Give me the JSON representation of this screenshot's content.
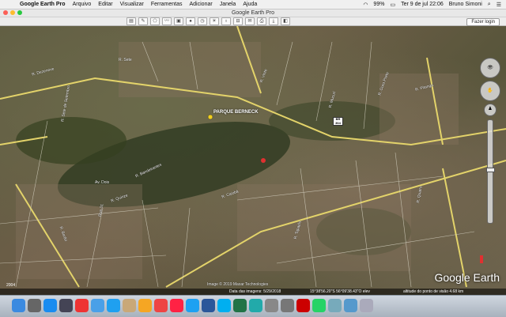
{
  "menubar": {
    "app_name": "Google Earth Pro",
    "items": [
      "Arquivo",
      "Editar",
      "Visualizar",
      "Ferramentas",
      "Adicionar",
      "Janela",
      "Ajuda"
    ],
    "battery": "99%",
    "datetime": "Ter 9 de jul  22:06",
    "user": "Bruno Simoni"
  },
  "window": {
    "title": "Google Earth Pro"
  },
  "toolbar": {
    "login_label": "Fazer login"
  },
  "map": {
    "place_label": "PARQUE BERNECK",
    "road_number": "BR 364",
    "branding": "Google Earth",
    "copyright": "Image © 2019 Maxar Technologies",
    "scale_label": "2004",
    "status": {
      "date": "Data das imagens: 5/29/2018",
      "coords": "15°38'56.20\"S  56°09'38.43\"O  elev",
      "altitude": "altitude do ponto de visão  4.68 km"
    },
    "street_labels": [
      "R. Dezenove",
      "R. Sete",
      "R. Vinte",
      "R. Bandeirantes",
      "R. Quinze",
      "R. Caiobá",
      "R. Barão",
      "Av. Dois",
      "R. Tapajós",
      "R. Mucuri",
      "R. Ouro Preto",
      "R. Pitanga",
      "Rua 01",
      "R. Quatro",
      "R. Sete de Setembro"
    ]
  },
  "dock": {
    "apps": [
      {
        "icon": "finder-icon",
        "color": "#3b8ae0"
      },
      {
        "icon": "launchpad-icon",
        "color": "#666"
      },
      {
        "icon": "appstore-icon",
        "color": "#1a8cf0"
      },
      {
        "icon": "earth-icon",
        "color": "#445"
      },
      {
        "icon": "calendar-icon",
        "color": "#e33"
      },
      {
        "icon": "mail-icon",
        "color": "#4aa0e8"
      },
      {
        "icon": "safari-icon",
        "color": "#1fa0f0"
      },
      {
        "icon": "contacts-icon",
        "color": "#c9a878"
      },
      {
        "icon": "photos-icon",
        "color": "#f5a623"
      },
      {
        "icon": "chrome-icon",
        "color": "#e44"
      },
      {
        "icon": "music-icon",
        "color": "#f24"
      },
      {
        "icon": "twitter-icon",
        "color": "#1da1f2"
      },
      {
        "icon": "word-icon",
        "color": "#2b579a"
      },
      {
        "icon": "skype-icon",
        "color": "#00aff0"
      },
      {
        "icon": "excel-icon",
        "color": "#217346"
      },
      {
        "icon": "browser-icon",
        "color": "#2aa"
      },
      {
        "icon": "preview-icon",
        "color": "#888"
      },
      {
        "icon": "system-prefs-icon",
        "color": "#777"
      },
      {
        "icon": "acrobat-icon",
        "color": "#c00"
      },
      {
        "icon": "whatsapp-icon",
        "color": "#25d366"
      },
      {
        "icon": "folder-icon",
        "color": "#7ab"
      },
      {
        "icon": "downloads-icon",
        "color": "#59c"
      },
      {
        "icon": "trash-icon",
        "color": "#aab"
      }
    ]
  }
}
